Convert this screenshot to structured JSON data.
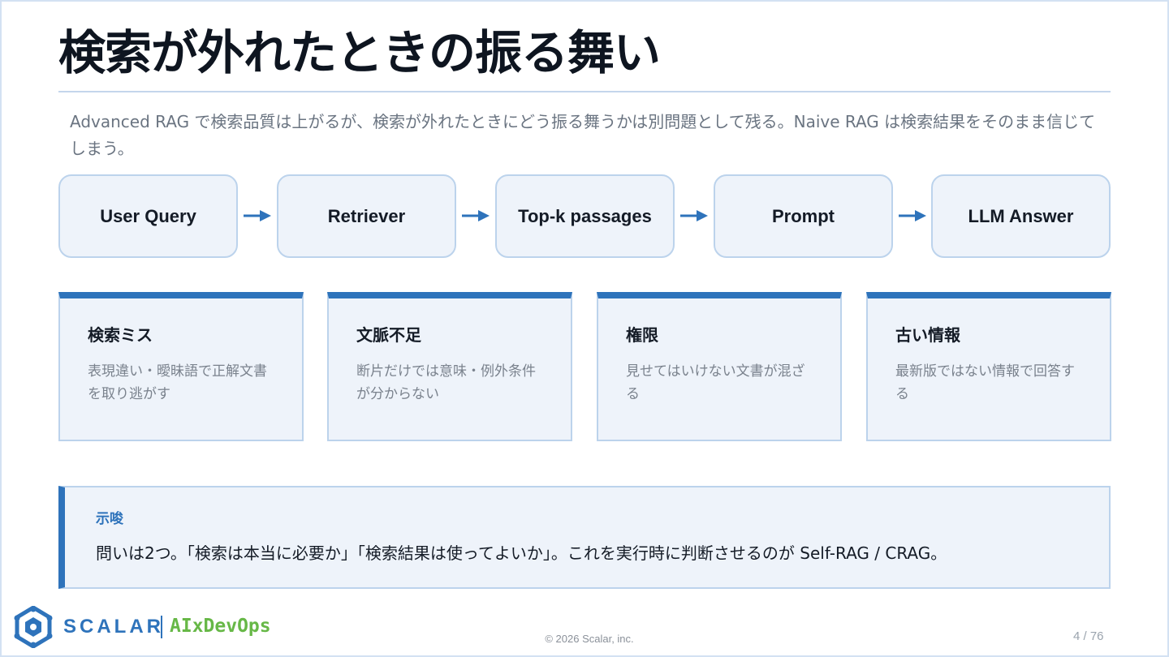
{
  "title": "検索が外れたときの振る舞い",
  "lead": "Advanced RAG で検索品質は上がるが、検索が外れたときにどう振る舞うかは別問題として残る。Naive RAG は検索結果をそのまま信じてしまう。",
  "flow": [
    "User Query",
    "Retriever",
    "Top-k passages",
    "Prompt",
    "LLM Answer"
  ],
  "cards": [
    {
      "title": "検索ミス",
      "desc": "表現違い・曖昧語で正解文書を取り逃がす"
    },
    {
      "title": "文脈不足",
      "desc": "断片だけでは意味・例外条件が分からない"
    },
    {
      "title": "権限",
      "desc": "見せてはいけない文書が混ざる"
    },
    {
      "title": "古い情報",
      "desc": "最新版ではない情報で回答する"
    }
  ],
  "callout": {
    "label": "示唆",
    "text": "問いは2つ。「検索は本当に必要か」「検索結果は使ってよいか」。これを実行時に判断させるのが Self-RAG / CRAG。"
  },
  "footer": {
    "brand": "SCALAR",
    "sub": "AIxDevOps",
    "copyright": "© 2026 Scalar, inc.",
    "page": "4 / 76"
  },
  "colors": {
    "accent": "#2e73bb",
    "box_fill": "#eef3fa",
    "box_border": "#bcd3ec",
    "brand_green": "#67b847"
  }
}
